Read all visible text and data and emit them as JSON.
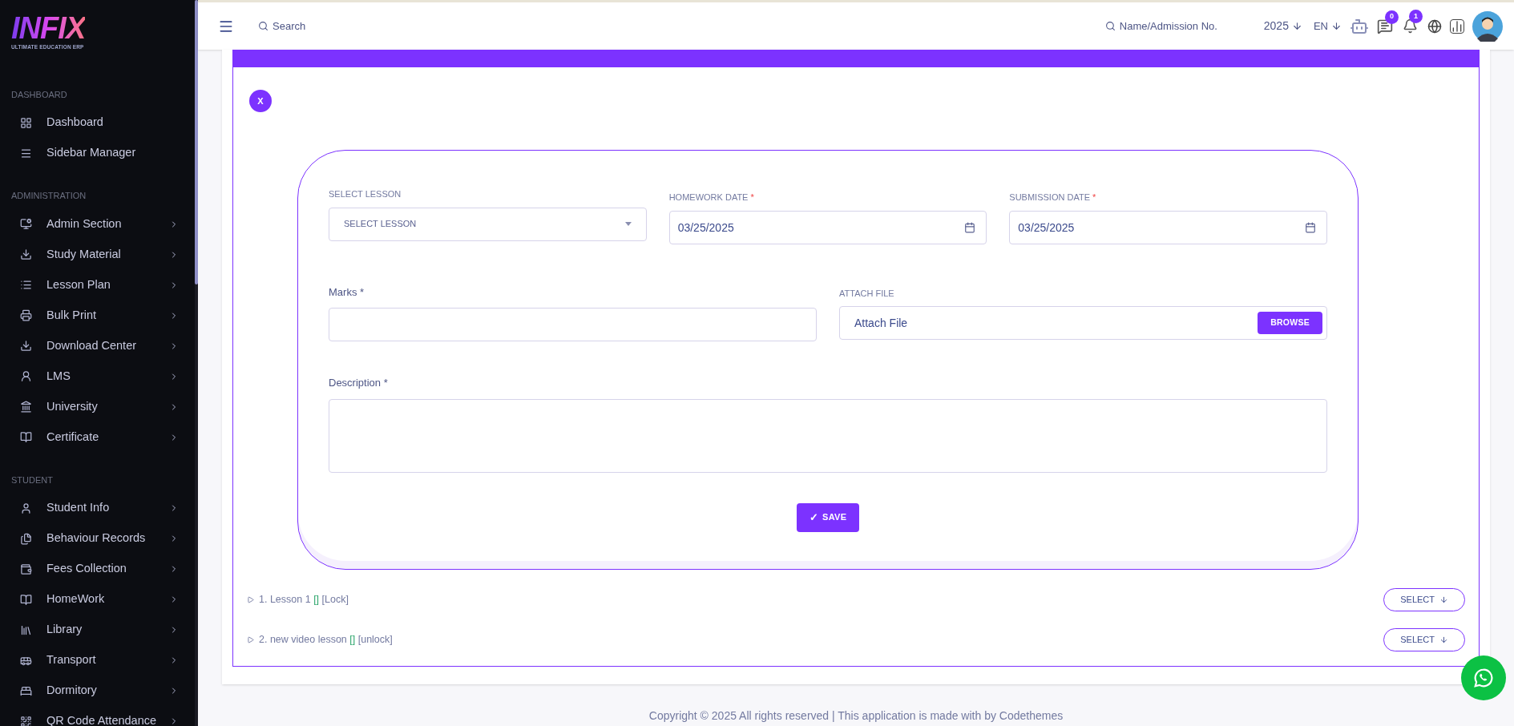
{
  "logo": {
    "title": "INFIX",
    "subtitle": "ULTIMATE EDUCATION ERP"
  },
  "sidebar": {
    "sections": [
      {
        "heading": "DASHBOARD",
        "items": [
          {
            "label": "Dashboard",
            "submenu": false
          },
          {
            "label": "Sidebar Manager",
            "submenu": false
          }
        ]
      },
      {
        "heading": "ADMINISTRATION",
        "items": [
          {
            "label": "Admin Section",
            "submenu": true
          },
          {
            "label": "Study Material",
            "submenu": true
          },
          {
            "label": "Lesson Plan",
            "submenu": true
          },
          {
            "label": "Bulk Print",
            "submenu": true
          },
          {
            "label": "Download Center",
            "submenu": true
          },
          {
            "label": "LMS",
            "submenu": true
          },
          {
            "label": "University",
            "submenu": true
          },
          {
            "label": "Certificate",
            "submenu": true
          }
        ]
      },
      {
        "heading": "STUDENT",
        "items": [
          {
            "label": "Student Info",
            "submenu": true
          },
          {
            "label": "Behaviour Records",
            "submenu": true
          },
          {
            "label": "Fees Collection",
            "submenu": true
          },
          {
            "label": "HomeWork",
            "submenu": true
          },
          {
            "label": "Library",
            "submenu": true
          },
          {
            "label": "Transport",
            "submenu": true
          },
          {
            "label": "Dormitory",
            "submenu": true
          },
          {
            "label": "QR Code Attendance",
            "submenu": true
          }
        ]
      }
    ]
  },
  "topbar": {
    "search": {
      "placeholder": "Search"
    },
    "student_search": {
      "placeholder": "Name/Admission No."
    },
    "year": "2025",
    "language": "EN",
    "messages_badge": "0",
    "notifications_badge": "1"
  },
  "close_button": "X",
  "form": {
    "select_lesson": {
      "label": "SELECT LESSON",
      "placeholder": "SELECT LESSON"
    },
    "homework_date": {
      "label": "HOMEWORK DATE",
      "required": "*",
      "value": "03/25/2025"
    },
    "submission_date": {
      "label": "SUBMISSION DATE",
      "required": "*",
      "value": "03/25/2025"
    },
    "marks": {
      "label": "Marks *"
    },
    "attach_file": {
      "label": "ATTACH FILE",
      "placeholder": "Attach File",
      "button": "BROWSE"
    },
    "description": {
      "label": "Description *"
    },
    "save": {
      "check": "✓",
      "label": "SAVE"
    }
  },
  "lessons": [
    {
      "title": "1. Lesson 1",
      "brackets": "[]",
      "status": "[Lock]",
      "button": "SELECT"
    },
    {
      "title": "2. new video lesson",
      "brackets": "[]",
      "status": "[unlock]",
      "button": "SELECT"
    }
  ],
  "footer": {
    "text": "Copyright © 2025 All rights reserved | This application is made with by Codethemes"
  }
}
